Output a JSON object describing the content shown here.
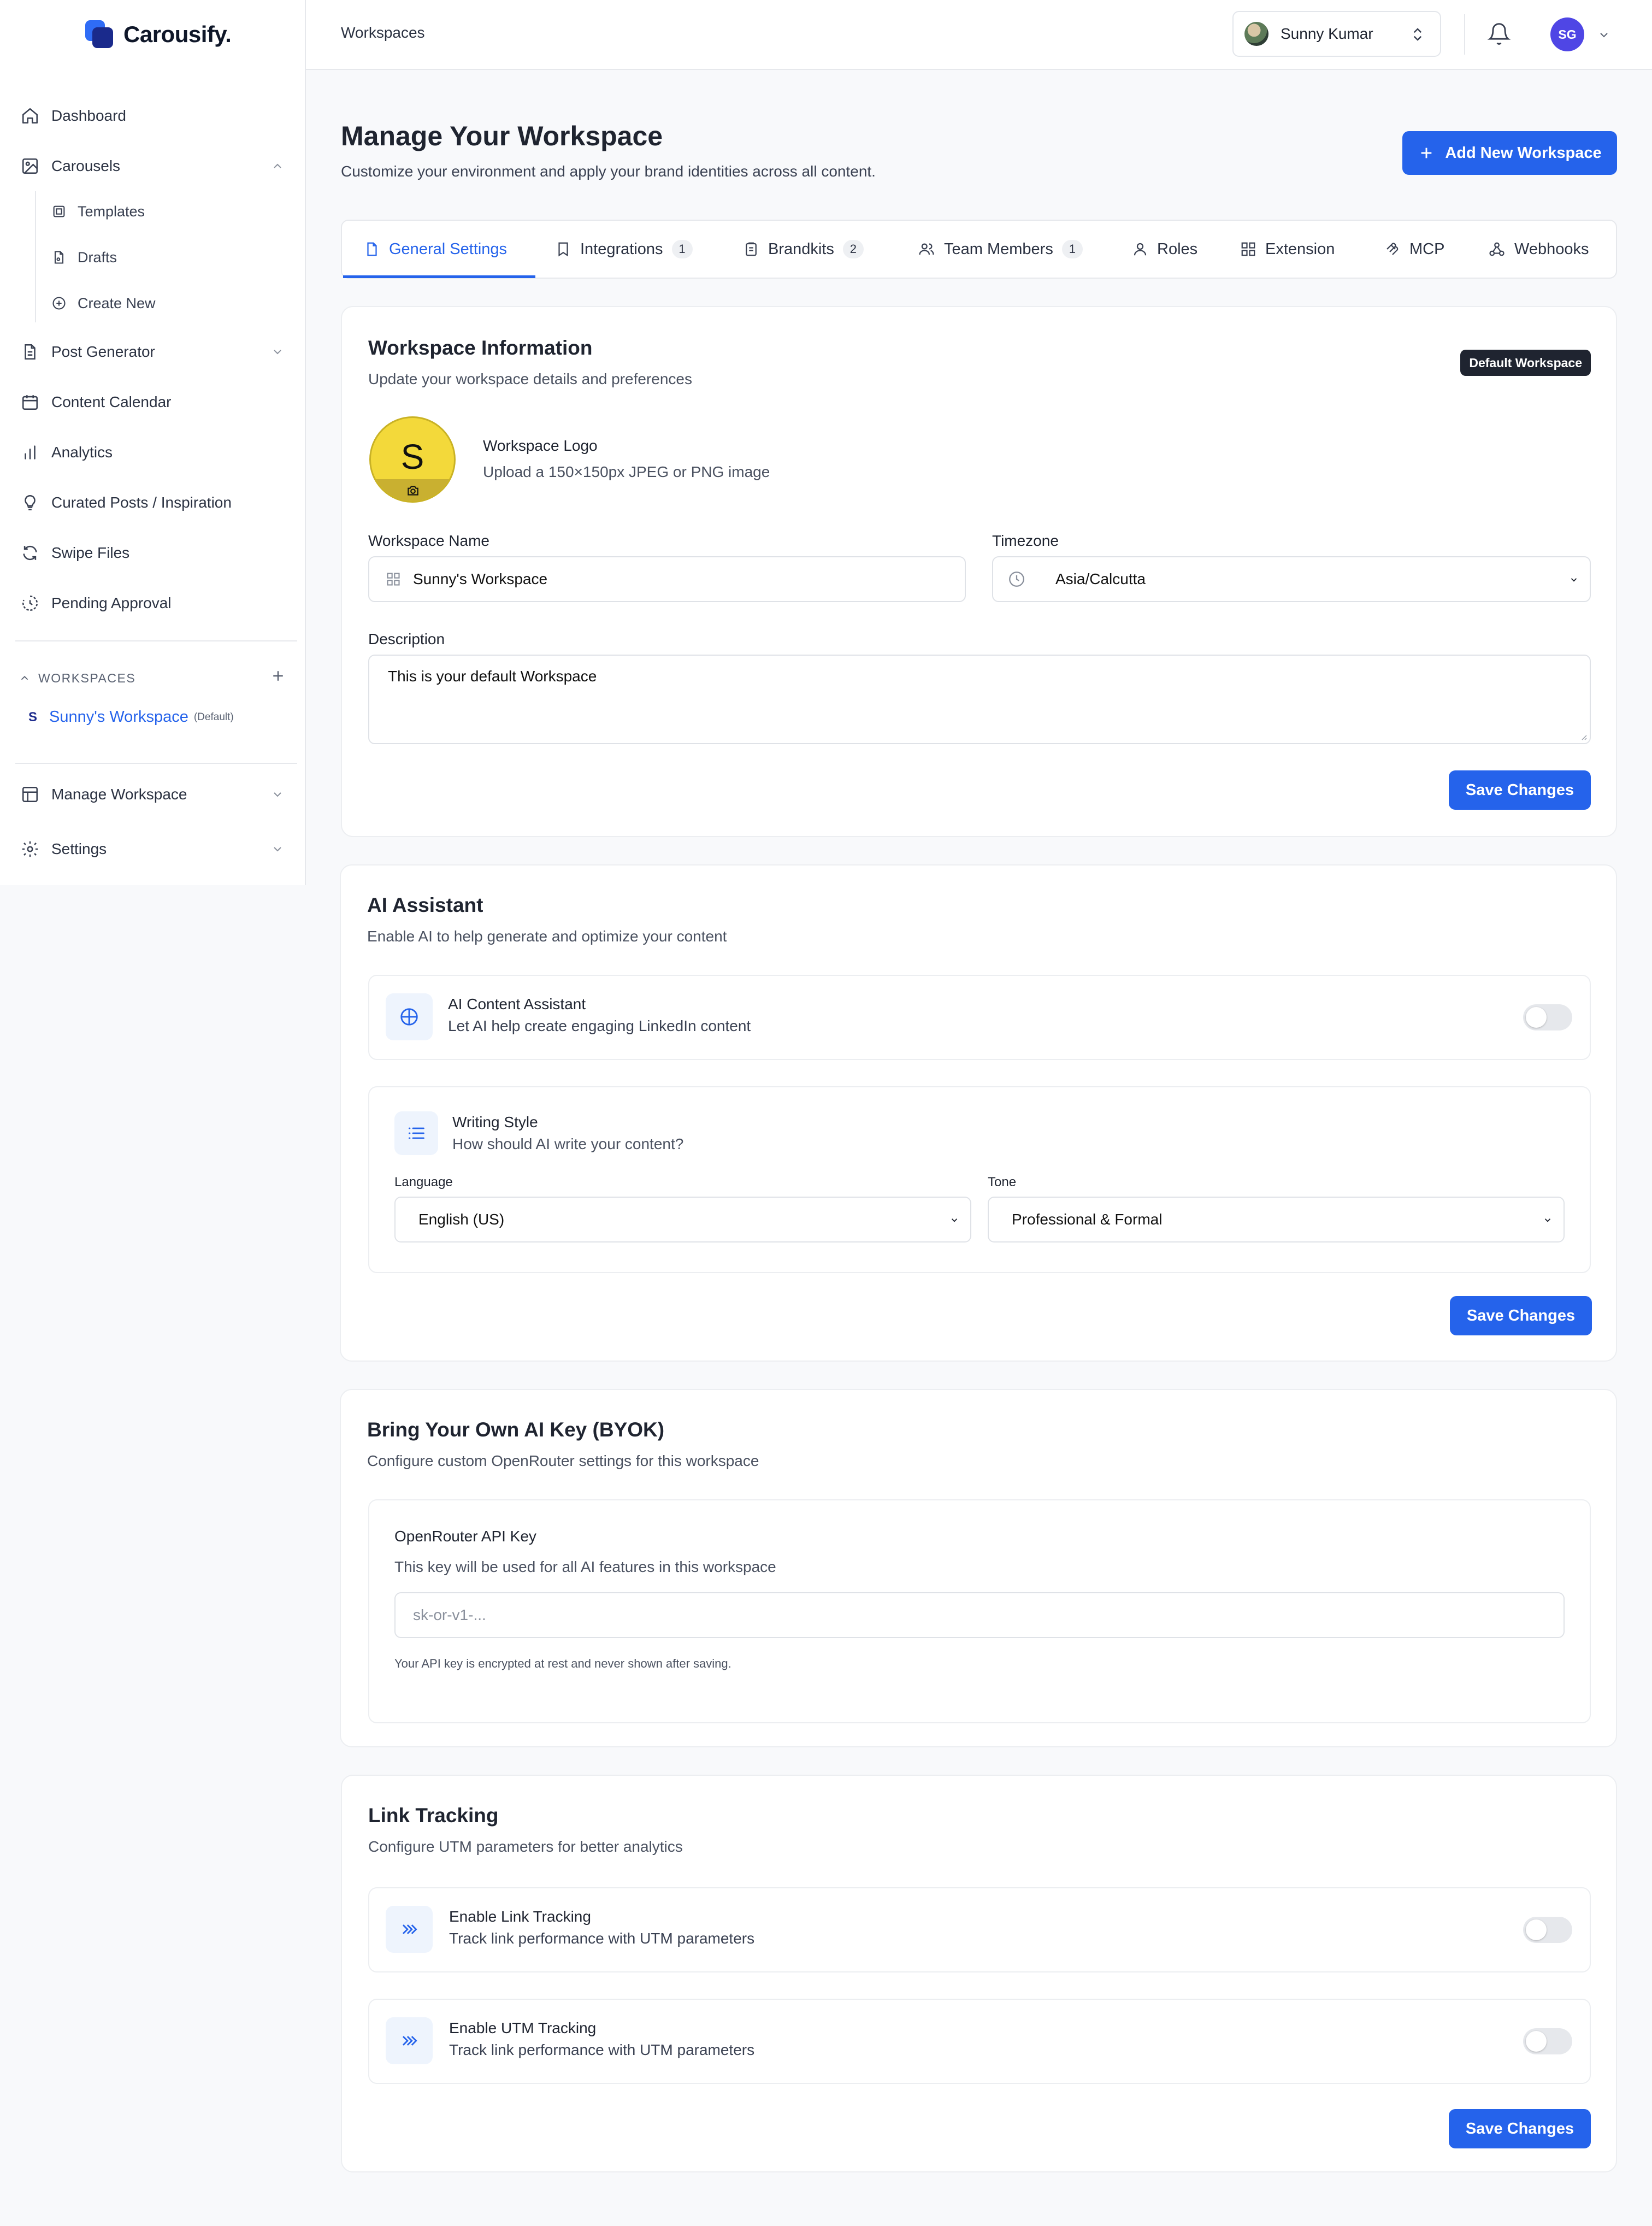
{
  "app": {
    "name": "Carousify."
  },
  "sidebar": {
    "items": [
      {
        "label": "Dashboard",
        "icon": "home-icon"
      },
      {
        "label": "Carousels",
        "icon": "image-icon"
      },
      {
        "label": "Post Generator",
        "icon": "document-icon"
      },
      {
        "label": "Content Calendar",
        "icon": "calendar-icon"
      },
      {
        "label": "Analytics",
        "icon": "bar-chart-icon"
      },
      {
        "label": "Curated Posts / Inspiration",
        "icon": "lightbulb-icon"
      },
      {
        "label": "Swipe Files",
        "icon": "refresh-icon"
      },
      {
        "label": "Pending Approval",
        "icon": "pending-icon"
      }
    ],
    "carousel_subitems": [
      {
        "label": "Templates",
        "icon": "template-icon"
      },
      {
        "label": "Drafts",
        "icon": "draft-icon"
      },
      {
        "label": "Create New",
        "icon": "plus-circle-icon"
      }
    ],
    "workspaces_header": "WORKSPACES",
    "workspace": {
      "initial": "S",
      "name": "Sunny's Workspace",
      "tag": "(Default)"
    },
    "manage_workspace": "Manage Workspace",
    "settings": "Settings"
  },
  "topbar": {
    "breadcrumb": "Workspaces",
    "user_name": "Sunny Kumar",
    "avatar_initials": "SG"
  },
  "page": {
    "title": "Manage Your Workspace",
    "subtitle": "Customize your environment and apply your brand identities across all content.",
    "add_button": "Add New Workspace"
  },
  "tabs": [
    {
      "label": "General Settings",
      "badge": null,
      "icon": "file-icon"
    },
    {
      "label": "Integrations",
      "badge": "1",
      "icon": "bookmark-icon"
    },
    {
      "label": "Brandkits",
      "badge": "2",
      "icon": "clipboard-icon"
    },
    {
      "label": "Team Members",
      "badge": "1",
      "icon": "users-icon"
    },
    {
      "label": "Roles",
      "badge": null,
      "icon": "user-icon"
    },
    {
      "label": "Extension",
      "badge": null,
      "icon": "grid-icon"
    },
    {
      "label": "MCP",
      "badge": null,
      "icon": "mcp-icon"
    },
    {
      "label": "Webhooks",
      "badge": null,
      "icon": "webhook-icon"
    }
  ],
  "workspace_info": {
    "title": "Workspace Information",
    "subtitle": "Update your workspace details and preferences",
    "default_badge": "Default Workspace",
    "logo_letter": "S",
    "logo_title": "Workspace Logo",
    "logo_hint": "Upload a 150×150px JPEG or PNG image",
    "name_label": "Workspace Name",
    "name_value": "Sunny's Workspace",
    "timezone_label": "Timezone",
    "timezone_value": "Asia/Calcutta",
    "description_label": "Description",
    "description_value": "This is your default Workspace",
    "save": "Save Changes"
  },
  "ai_assistant": {
    "title": "AI Assistant",
    "subtitle": "Enable AI to help generate and optimize your content",
    "content_assistant_title": "AI Content Assistant",
    "content_assistant_sub": "Let AI help create engaging LinkedIn content",
    "content_assistant_enabled": false,
    "writing_style_title": "Writing Style",
    "writing_style_sub": "How should AI write your content?",
    "language_label": "Language",
    "language_value": "English (US)",
    "tone_label": "Tone",
    "tone_value": "Professional & Formal",
    "save": "Save Changes"
  },
  "byok": {
    "title": "Bring Your Own AI Key (BYOK)",
    "subtitle": "Configure custom OpenRouter settings for this workspace",
    "key_label": "OpenRouter API Key",
    "key_hint": "This key will be used for all AI features in this workspace",
    "key_placeholder": "sk-or-v1-...",
    "key_note": "Your API key is encrypted at rest and never shown after saving."
  },
  "link_tracking": {
    "title": "Link Tracking",
    "subtitle": "Configure UTM parameters for better analytics",
    "link_title": "Enable Link Tracking",
    "link_sub": "Track link performance with UTM parameters",
    "link_enabled": false,
    "utm_title": "Enable UTM Tracking",
    "utm_sub": "Track link performance with UTM parameters",
    "utm_enabled": false,
    "save": "Save Changes"
  },
  "colors": {
    "primary": "#2563eb",
    "text": "#1f2430",
    "muted": "#4a5160",
    "brand_dark": "#1a2a8c"
  }
}
